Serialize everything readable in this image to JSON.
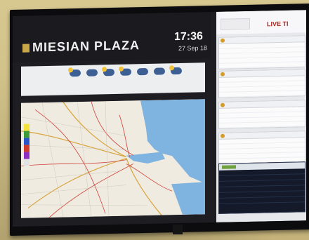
{
  "screen": {
    "title": "MIESIAN PLAZA",
    "time": "17:36",
    "date": "27 Sep 18",
    "logo_text": "",
    "live_label": "LIVE TI"
  },
  "forecast": {
    "label": "",
    "items": [
      {
        "icon": "sun-cloud-icon"
      },
      {
        "icon": "cloud-icon"
      },
      {
        "icon": "sun-cloud-icon"
      },
      {
        "icon": "sun-cloud-icon"
      },
      {
        "icon": "cloud-icon"
      },
      {
        "icon": "cloud-icon"
      },
      {
        "icon": "sun-cloud-icon"
      }
    ]
  },
  "map": {
    "legend_colors": [
      "#f4e23a",
      "#3a9d3a",
      "#2a55c8",
      "#cf3b2b",
      "#8b2dbf",
      "#e2e2e2"
    ]
  },
  "bus_stops": [
    {
      "rows": 5
    },
    {
      "rows": 4
    },
    {
      "rows": 4
    },
    {
      "rows": 5
    }
  ],
  "alerts": {
    "rows": 6
  },
  "colors": {
    "accent": "#c9a849",
    "live": "#b0251f"
  }
}
